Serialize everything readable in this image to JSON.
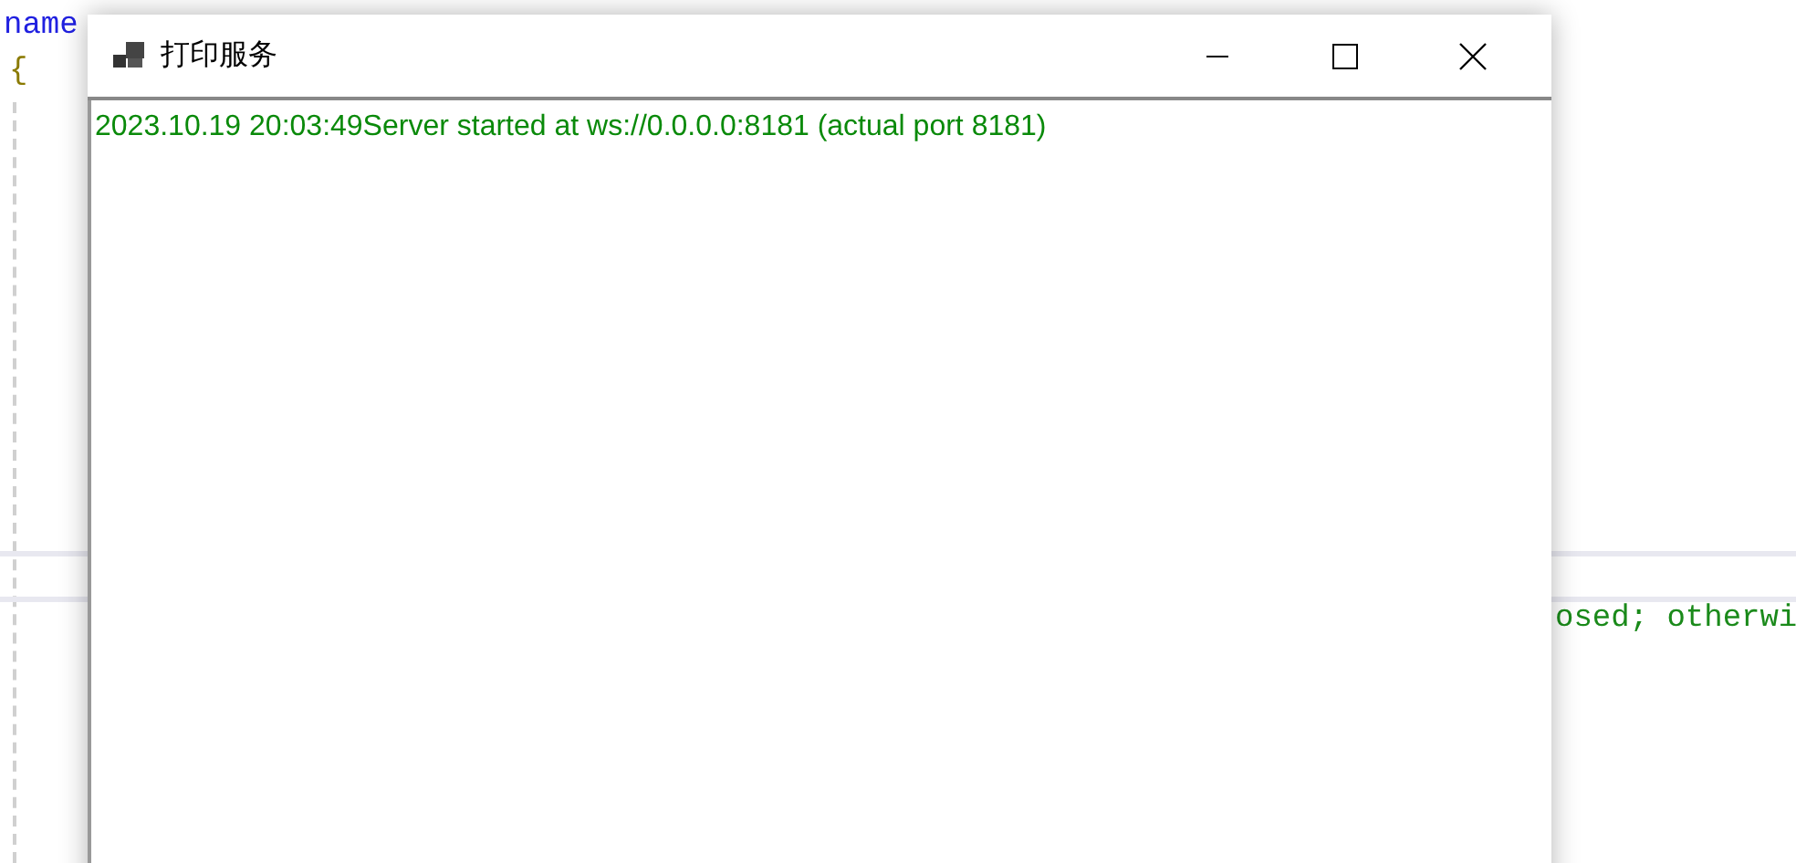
{
  "editor": {
    "lines": [
      {
        "kind": "keyword",
        "text": "name"
      },
      {
        "kind": "brace",
        "text": "{"
      }
    ],
    "comment_fragment": "osed; otherwi"
  },
  "window": {
    "title": "打印服务",
    "log_lines": [
      "2023.10.19 20:03:49Server started at ws://0.0.0.0:8181 (actual port 8181)"
    ]
  }
}
